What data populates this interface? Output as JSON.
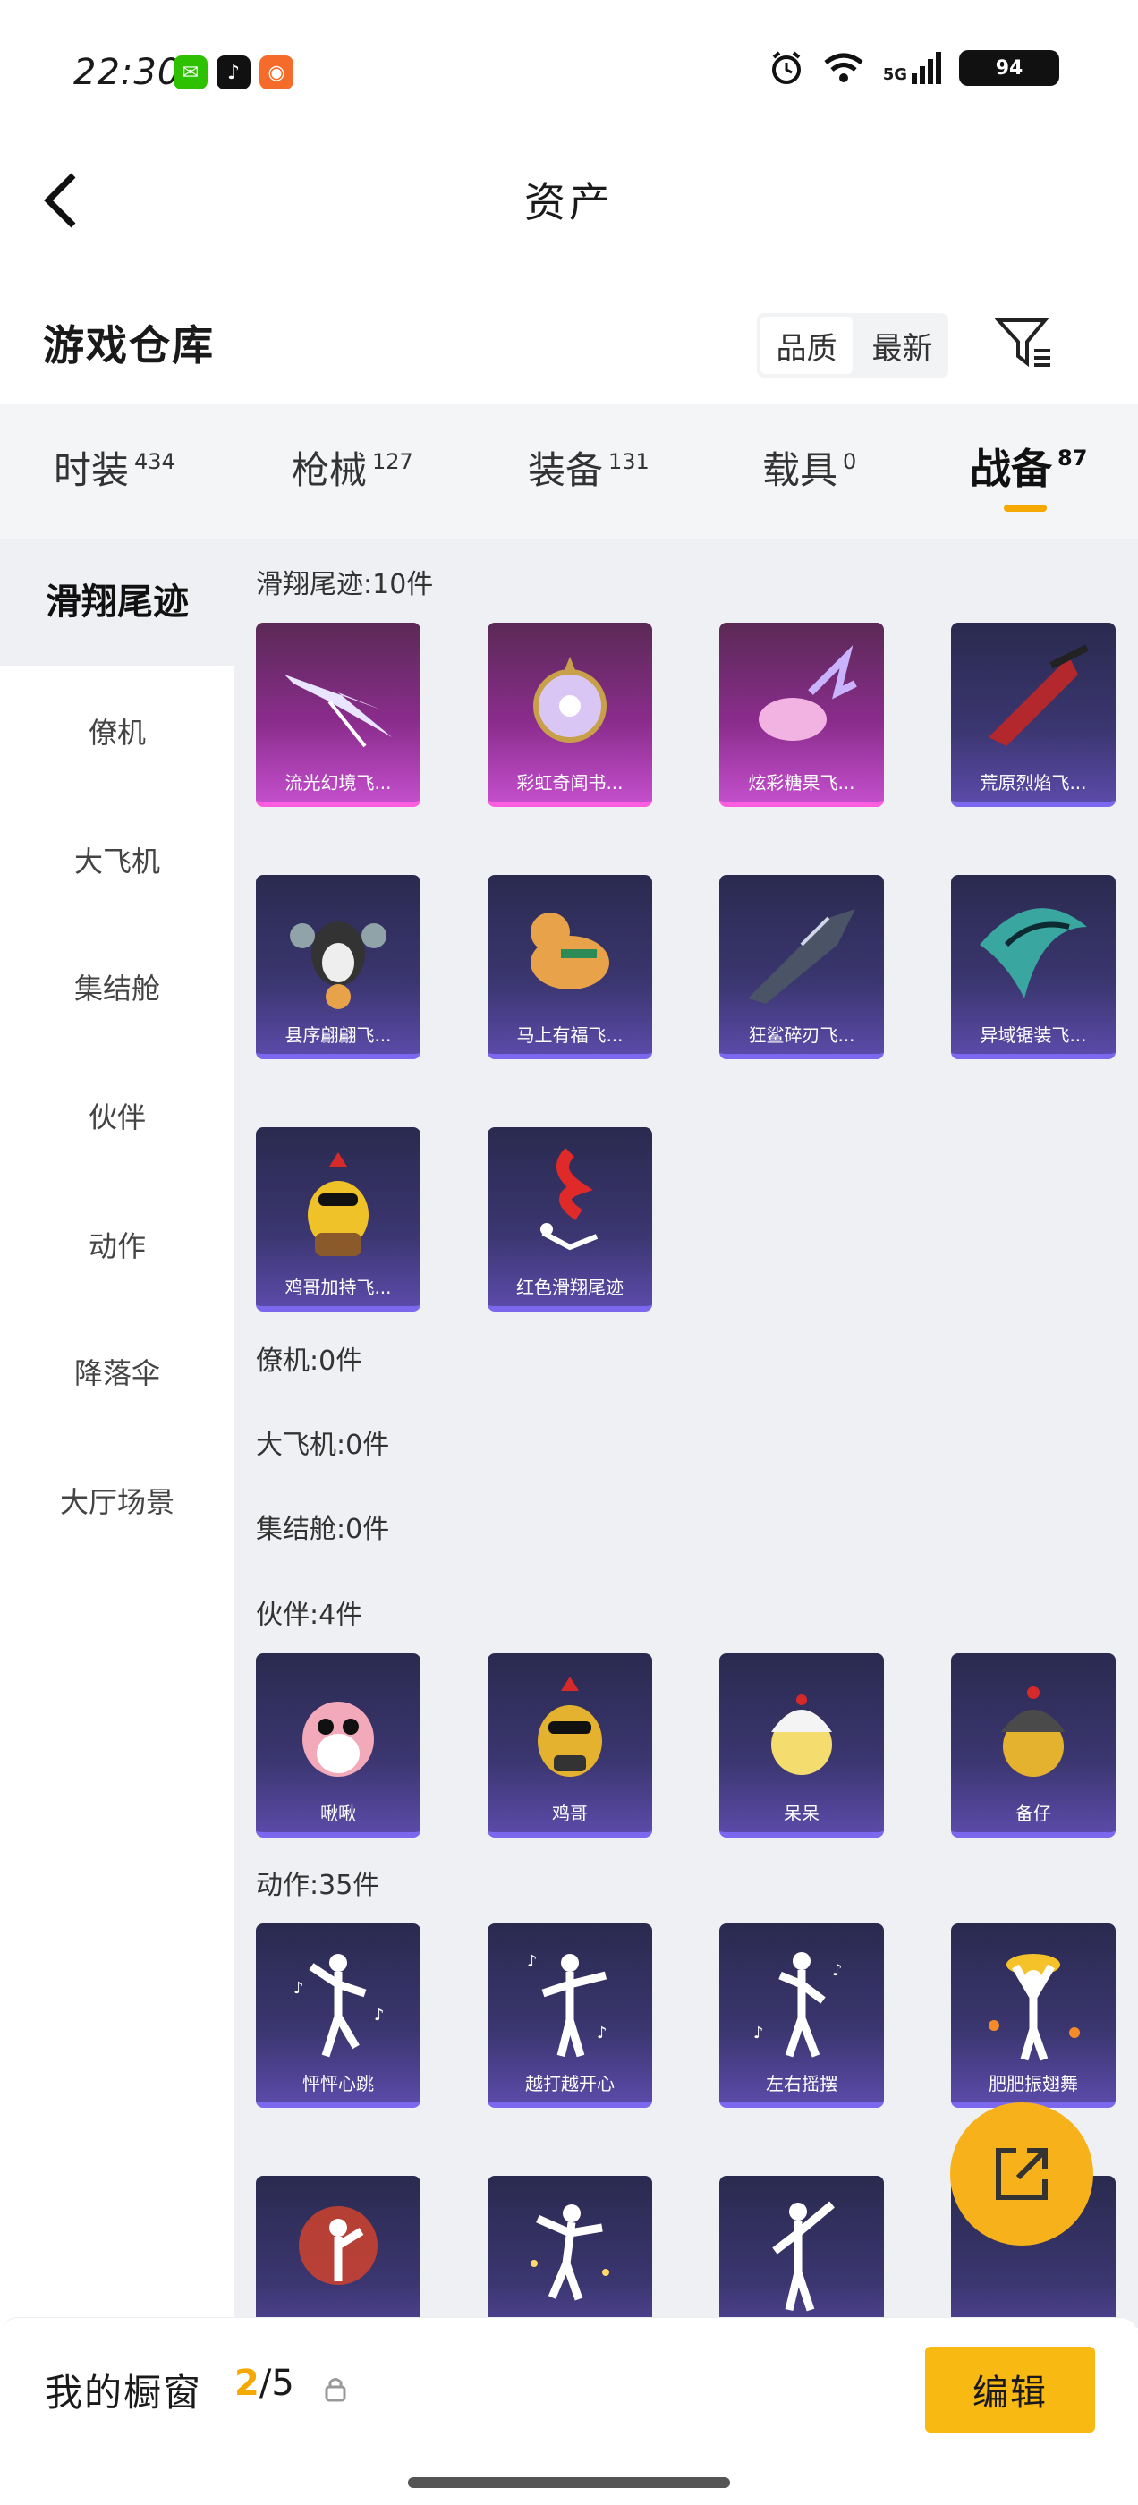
{
  "status_bar": {
    "time": "22:30",
    "network": "5G",
    "battery": "94"
  },
  "header": {
    "title": "资产",
    "section_title": "游戏仓库"
  },
  "sort": {
    "options": [
      "品质",
      "最新"
    ],
    "active_index": 0
  },
  "tabs": [
    {
      "label": "时装",
      "count": "434"
    },
    {
      "label": "枪械",
      "count": "127"
    },
    {
      "label": "装备",
      "count": "131"
    },
    {
      "label": "载具",
      "count": "0"
    },
    {
      "label": "战备",
      "count": "87",
      "active": true
    }
  ],
  "sidebar": {
    "items": [
      "滑翔尾迹",
      "僚机",
      "大飞机",
      "集结舱",
      "伙伴",
      "动作",
      "降落伞",
      "大厅场景"
    ],
    "active_index": 0
  },
  "groups": {
    "glide": {
      "title": "滑翔尾迹:10件",
      "items": [
        "流光幻境飞...",
        "彩虹奇闻书...",
        "炫彩糖果飞...",
        "荒原烈焰飞...",
        "县序翩翩飞...",
        "马上有福飞...",
        "狂鲨碎刃飞...",
        "异域锯装飞...",
        "鸡哥加持飞...",
        "红色滑翔尾迹"
      ]
    },
    "wingman": {
      "title": "僚机:0件"
    },
    "plane": {
      "title": "大飞机:0件"
    },
    "pod": {
      "title": "集结舱:0件"
    },
    "partner": {
      "title": "伙伴:4件",
      "items": [
        "啾啾",
        "鸡哥",
        "呆呆",
        "备仔"
      ]
    },
    "emote": {
      "title": "动作:35件",
      "items": [
        "怦怦心跳",
        "越打越开心",
        "左右摇摆",
        "肥肥振翅舞",
        "",
        "",
        "",
        ""
      ]
    }
  },
  "bottom": {
    "label": "我的橱窗",
    "current": "2",
    "total": "/5",
    "edit": "编辑"
  },
  "colors": {
    "accent": "#f5a800",
    "purple_card": "#3b3670",
    "pink_card": "#8a2c8c"
  }
}
